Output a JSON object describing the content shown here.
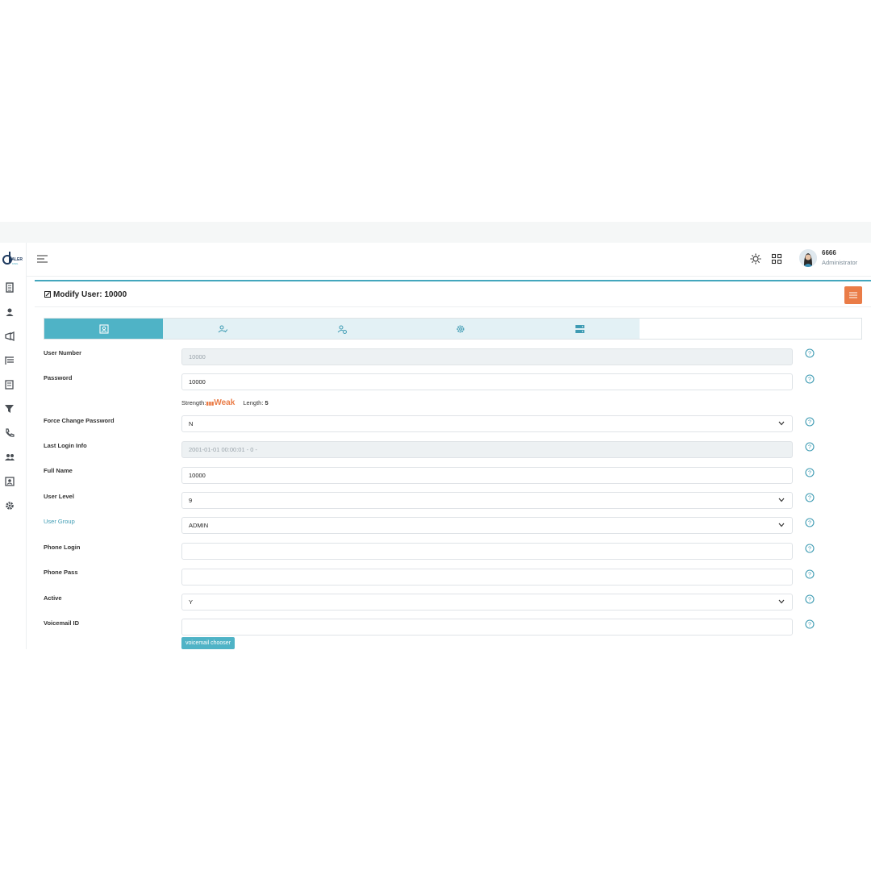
{
  "app": {
    "logo_text": "DIALER"
  },
  "sidebar": {
    "icons": [
      "reports-icon",
      "user-icon",
      "campaign-megaphone-icon",
      "lists-icon",
      "scripts-icon",
      "filter-icon",
      "phone-call-icon",
      "user-groups-icon",
      "contacts-icon",
      "settings-gear-icon"
    ]
  },
  "header": {
    "user_name": "6666",
    "user_role": "Administrator"
  },
  "page": {
    "title": "Modify User: 10000"
  },
  "tabs": [
    {
      "icon": "user-profile-icon",
      "active": true
    },
    {
      "icon": "user-check-icon",
      "active": false
    },
    {
      "icon": "user-settings-icon",
      "active": false
    },
    {
      "icon": "gear-icon",
      "active": false
    },
    {
      "icon": "server-icon",
      "active": false
    }
  ],
  "form": {
    "user_number": {
      "label": "User Number",
      "value": "10000"
    },
    "password": {
      "label": "Password",
      "value": "10000"
    },
    "strength": {
      "label": "Strength:",
      "bars": "▮▮▮",
      "rating": "Weak",
      "length_label": "Length:",
      "length_value": "5"
    },
    "force_change_password": {
      "label": "Force Change Password",
      "value": "N"
    },
    "last_login_info": {
      "label": "Last Login Info",
      "value": "2001-01-01 00:00:01 - 0 -"
    },
    "full_name": {
      "label": "Full Name",
      "value": "10000"
    },
    "user_level": {
      "label": "User Level",
      "value": "9"
    },
    "user_group": {
      "label": "User Group",
      "value": "ADMIN"
    },
    "phone_login": {
      "label": "Phone Login",
      "value": ""
    },
    "phone_pass": {
      "label": "Phone Pass",
      "value": ""
    },
    "active": {
      "label": "Active",
      "value": "Y"
    },
    "voicemail_id": {
      "label": "Voicemail ID",
      "value": ""
    },
    "voicemail_chooser": "voicemail chooser"
  },
  "colors": {
    "accent": "#4fb3c6",
    "tab_bg": "#e3f1f5",
    "orange": "#ea7c47",
    "help_icon": "#3e9bb3"
  }
}
